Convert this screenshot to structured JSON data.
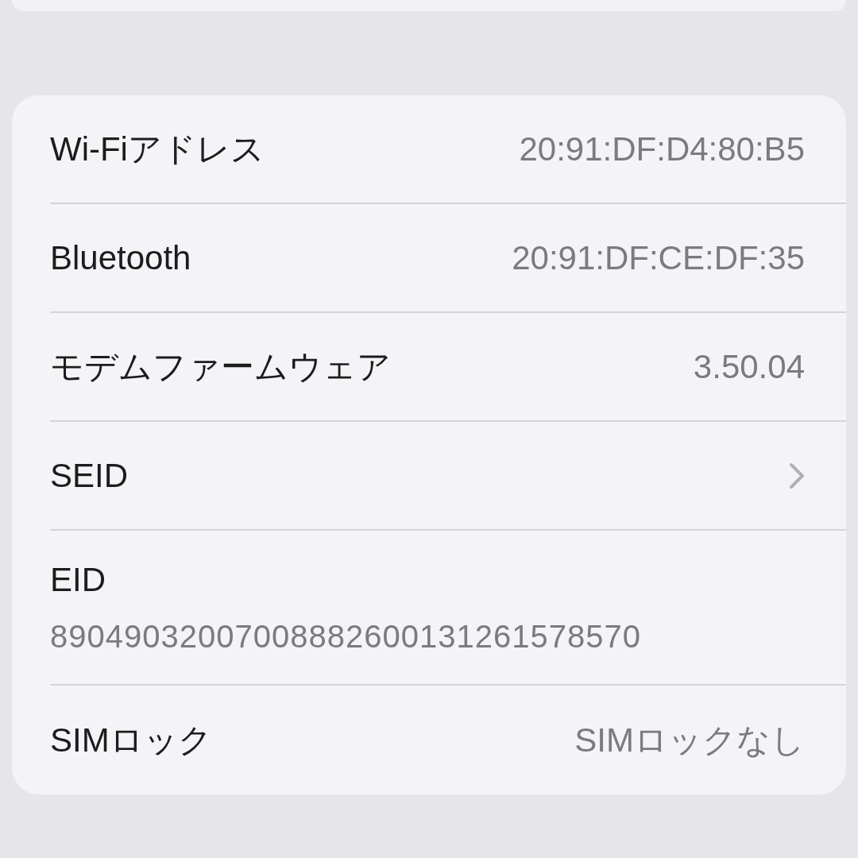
{
  "rows": [
    {
      "kind": "value",
      "label": "Wi-Fiアドレス",
      "value": "20:91:DF:D4:80:B5"
    },
    {
      "kind": "value",
      "label": "Bluetooth",
      "value": "20:91:DF:CE:DF:35"
    },
    {
      "kind": "value",
      "label": "モデムファームウェア",
      "value": "3.50.04"
    },
    {
      "kind": "disclosure",
      "label": "SEID"
    },
    {
      "kind": "stacked",
      "label": "EID",
      "value": "89049032007008882600131261578570"
    },
    {
      "kind": "value",
      "label": "SIMロック",
      "value": "SIMロックなし"
    }
  ]
}
